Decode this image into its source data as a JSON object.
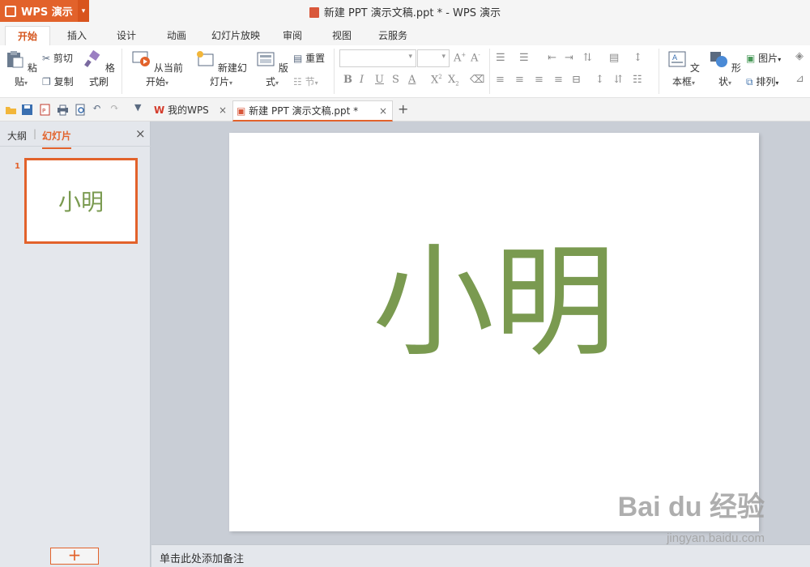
{
  "app": {
    "menu_label": "WPS 演示",
    "window_title": "新建 PPT 演示文稿.ppt * - WPS 演示"
  },
  "ribbon_tabs": [
    "开始",
    "插入",
    "设计",
    "动画",
    "幻灯片放映",
    "审阅",
    "视图",
    "云服务"
  ],
  "ribbon": {
    "paste": "粘贴",
    "cut": "剪切",
    "copy": "复制",
    "format_painter": "格式刷",
    "from_current": "从当前开始",
    "new_slide": "新建幻灯片",
    "layout": "版式",
    "reset": "重置",
    "section": "节",
    "text_box": "文本框",
    "shape": "形状",
    "picture": "图片",
    "arrange": "排列"
  },
  "doc_tabs": [
    {
      "label": "我的WPS"
    },
    {
      "label": "新建 PPT 演示文稿.ppt *"
    }
  ],
  "left_panel": {
    "tab_outline": "大纲",
    "tab_slides": "幻灯片",
    "slide_number": "1",
    "thumb_text": "小明",
    "add_button": "+"
  },
  "slide": {
    "text": "小明"
  },
  "notes_placeholder": "单击此处添加备注",
  "watermark": {
    "main": "Bai du 经验",
    "sub": "jingyan.baidu.com"
  },
  "colors": {
    "accent": "#e2622b",
    "slide_text": "#7a9a50"
  }
}
